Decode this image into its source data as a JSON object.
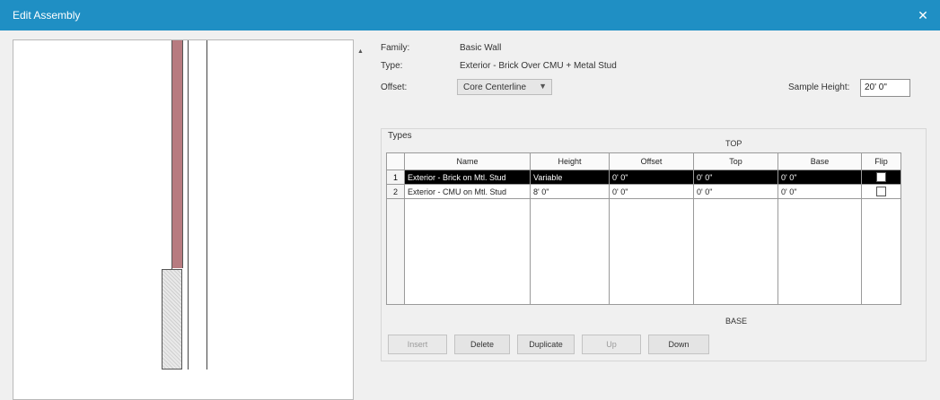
{
  "window": {
    "title": "Edit Assembly",
    "close_glyph": "✕"
  },
  "properties": {
    "family_label": "Family:",
    "family_value": "Basic Wall",
    "type_label": "Type:",
    "type_value": "Exterior - Brick Over CMU + Metal Stud",
    "offset_label": "Offset:",
    "offset_value": "Core Centerline",
    "sample_height_label": "Sample Height:",
    "sample_height_value": "20' 0\""
  },
  "layers": {
    "group_label": "Types",
    "top_label": "TOP",
    "bottom_label": "BASE",
    "columns": [
      "",
      "Name",
      "Height",
      "Offset",
      "Top",
      "Base",
      "Flip"
    ],
    "rows": [
      {
        "num": "1",
        "name": "Exterior - Brick on Mtl. Stud",
        "height": "Variable",
        "offset": "0' 0\"",
        "top": "0' 0\"",
        "base": "0' 0\"",
        "flip": false,
        "selected": true
      },
      {
        "num": "2",
        "name": "Exterior - CMU on Mtl. Stud",
        "height": "8' 0\"",
        "offset": "0' 0\"",
        "top": "0' 0\"",
        "base": "0' 0\"",
        "flip": false,
        "selected": false
      }
    ]
  },
  "buttons": {
    "insert": "Insert",
    "delete": "Delete",
    "duplicate": "Duplicate",
    "up": "Up",
    "down": "Down"
  },
  "colors": {
    "title_bar": "#1f8fc4",
    "brick_layer": "#b77b80",
    "selection": "#000000"
  }
}
